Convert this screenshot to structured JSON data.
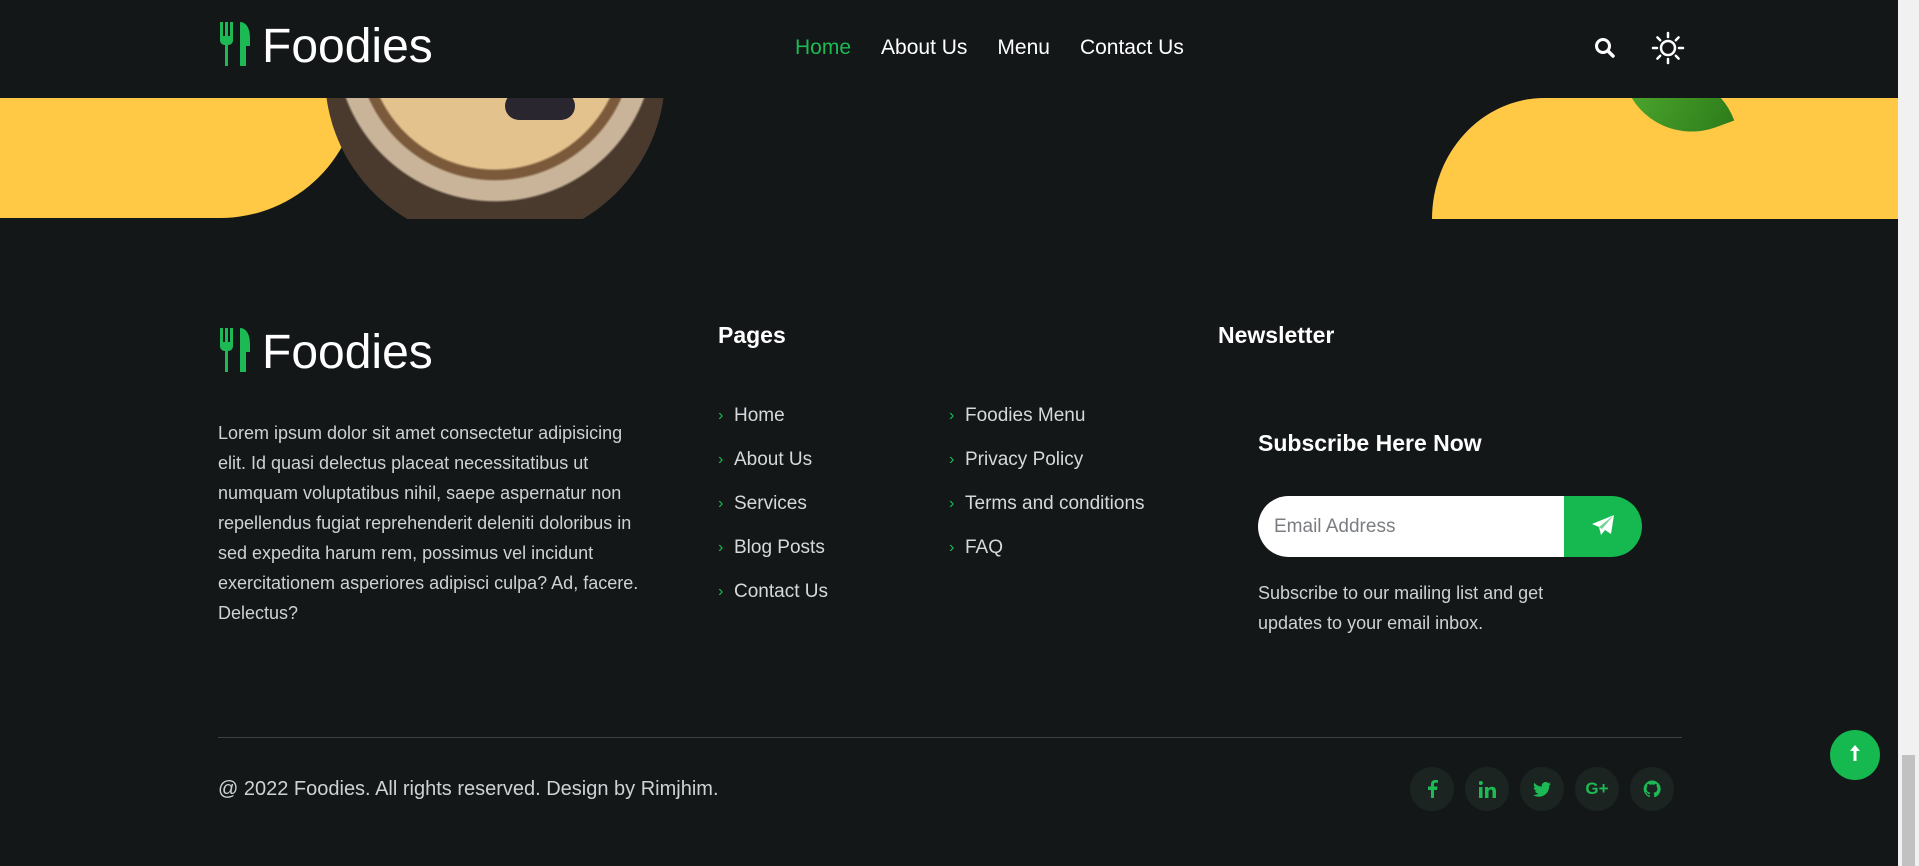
{
  "brand": {
    "name": "Foodies",
    "accent": "#1db954",
    "highlight": "#ffc845",
    "background": "#131718"
  },
  "header": {
    "nav": [
      {
        "label": "Home",
        "active": true
      },
      {
        "label": "About Us",
        "active": false
      },
      {
        "label": "Menu",
        "active": false
      },
      {
        "label": "Contact Us",
        "active": false
      }
    ],
    "icons": [
      "search-icon",
      "theme-toggle-sun-icon"
    ]
  },
  "footer": {
    "about_text": "Lorem ipsum dolor sit amet consectetur adipisicing elit. Id quasi delectus placeat necessitatibus ut numquam voluptatibus nihil, saepe aspernatur non repellendus fugiat reprehenderit deleniti doloribus in sed expedita harum rem, possimus vel incidunt exercitationem asperiores adipisci culpa? Ad, facere. Delectus?",
    "pages": {
      "title": "Pages",
      "col1": [
        "Home",
        "About Us",
        "Services",
        "Blog Posts",
        "Contact Us"
      ],
      "col2": [
        "Foodies Menu",
        "Privacy Policy",
        "Terms and conditions",
        "FAQ"
      ]
    },
    "newsletter": {
      "title": "Newsletter",
      "subtitle": "Subscribe Here Now",
      "email_placeholder": "Email Address",
      "note": "Subscribe to our mailing list and get updates to your email inbox."
    },
    "copyright": "@ 2022 Foodies. All rights reserved. Design by Rimjhim.",
    "socials": [
      "facebook-icon",
      "linkedin-icon",
      "twitter-icon",
      "google-plus-icon",
      "github-icon"
    ]
  }
}
